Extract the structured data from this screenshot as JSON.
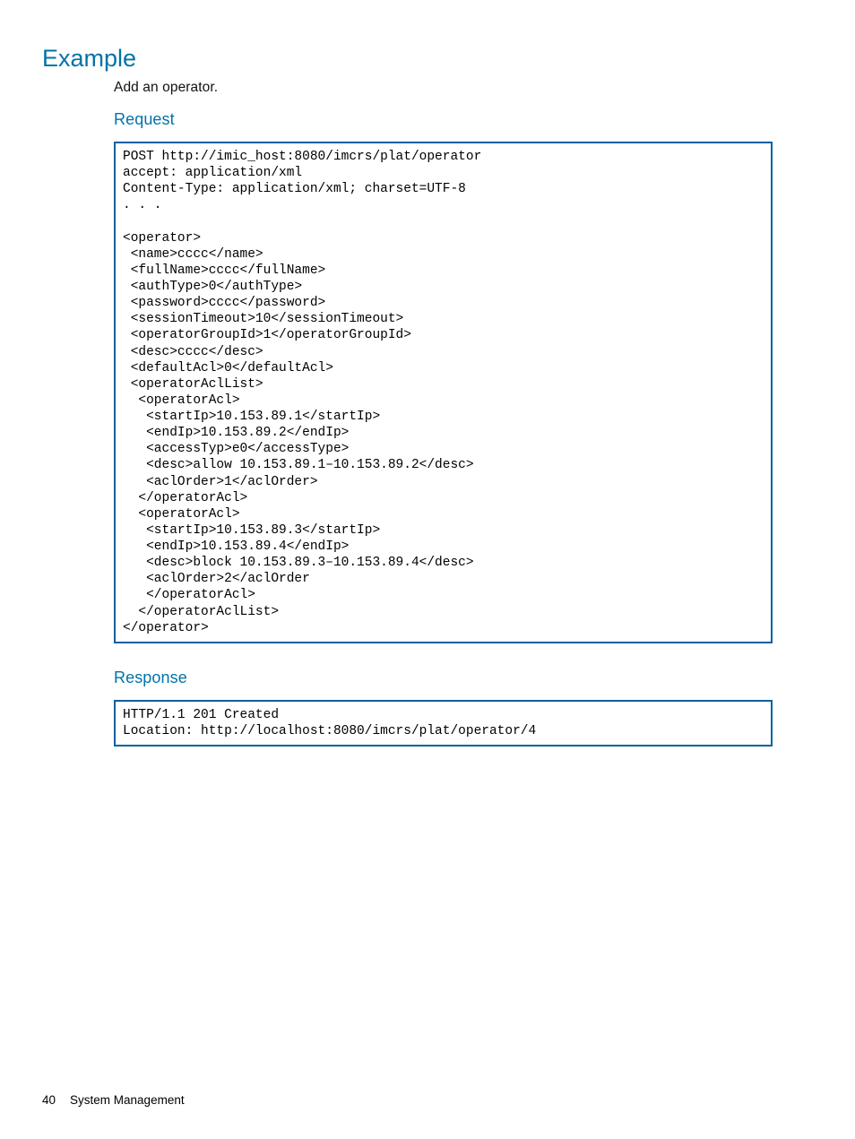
{
  "headings": {
    "example": "Example",
    "request": "Request",
    "response": "Response"
  },
  "intro": "Add an operator.",
  "request_code": "POST http://imic_host:8080/imcrs/plat/operator\naccept: application/xml\nContent-Type: application/xml; charset=UTF-8\n. . .\n\n<operator>\n <name>cccc</name>\n <fullName>cccc</fullName>\n <authType>0</authType>\n <password>cccc</password>\n <sessionTimeout>10</sessionTimeout>\n <operatorGroupId>1</operatorGroupId>\n <desc>cccc</desc>\n <defaultAcl>0</defaultAcl>\n <operatorAclList>\n  <operatorAcl>\n   <startIp>10.153.89.1</startIp>\n   <endIp>10.153.89.2</endIp>\n   <accessTyp>e0</accessType>\n   <desc>allow 10.153.89.1–10.153.89.2</desc>\n   <aclOrder>1</aclOrder>\n  </operatorAcl>\n  <operatorAcl>\n   <startIp>10.153.89.3</startIp>\n   <endIp>10.153.89.4</endIp>\n   <desc>block 10.153.89.3–10.153.89.4</desc>\n   <aclOrder>2</aclOrder\n   </operatorAcl>\n  </operatorAclList>\n</operator>",
  "response_code": "HTTP/1.1 201 Created\nLocation: http://localhost:8080/imcrs/plat/operator/4",
  "footer": {
    "page_number": "40",
    "section": "System Management"
  }
}
